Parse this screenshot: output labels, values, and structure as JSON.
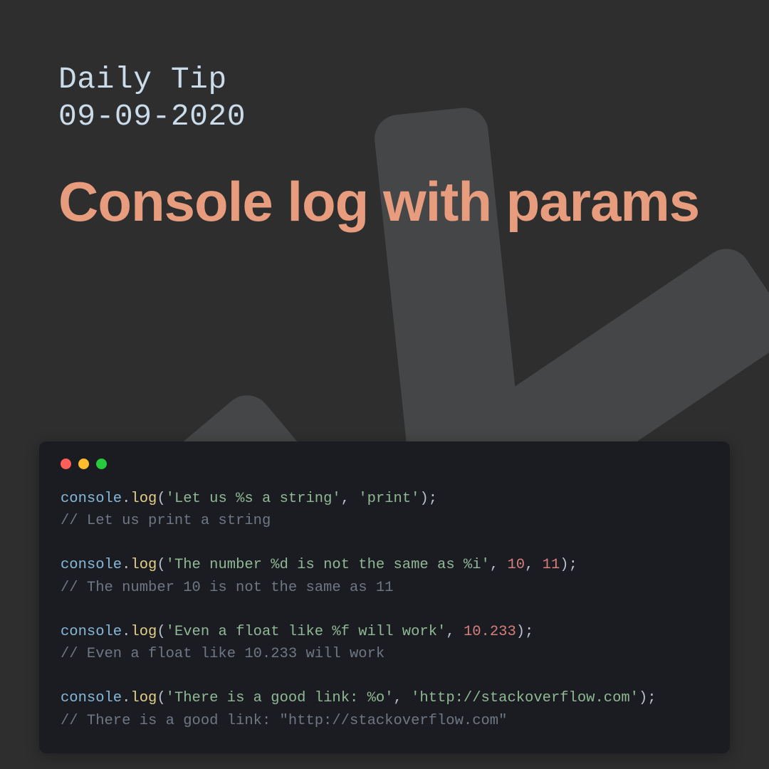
{
  "header": {
    "label_line1": "Daily Tip",
    "label_line2": "09-09-2020",
    "title": "Console log with params"
  },
  "window": {
    "dots": [
      "red",
      "yellow",
      "green"
    ]
  },
  "code": {
    "examples": [
      {
        "obj": "console",
        "fn": "log",
        "args": [
          "'Let us %s a string'",
          "'print'"
        ],
        "argTypes": [
          "str",
          "str"
        ],
        "comment": "// Let us print a string"
      },
      {
        "obj": "console",
        "fn": "log",
        "args": [
          "'The number %d is not the same as %i'",
          "10",
          "11"
        ],
        "argTypes": [
          "str",
          "num",
          "num"
        ],
        "comment": "// The number 10 is not the same as 11"
      },
      {
        "obj": "console",
        "fn": "log",
        "args": [
          "'Even a float like %f will work'",
          "10.233"
        ],
        "argTypes": [
          "str",
          "num"
        ],
        "comment": "// Even a float like 10.233 will work"
      },
      {
        "obj": "console",
        "fn": "log",
        "args": [
          "'There is a good link: %o'",
          "'http://stackoverflow.com'"
        ],
        "argTypes": [
          "str",
          "str"
        ],
        "comment": "// There is a good link: \"http://stackoverflow.com\""
      }
    ]
  }
}
